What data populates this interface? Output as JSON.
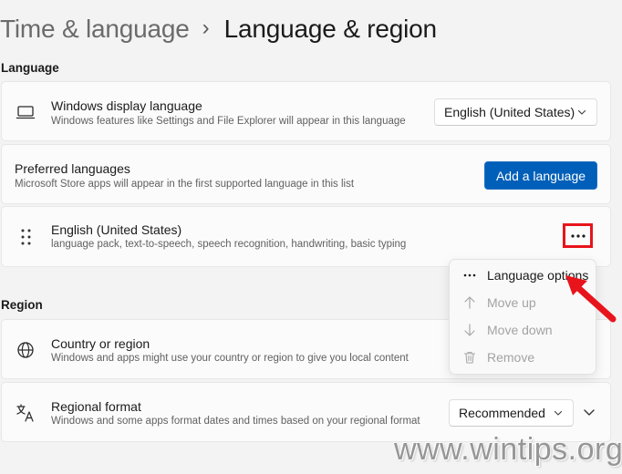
{
  "breadcrumb": {
    "parent": "Time & language",
    "separator": "›",
    "current": "Language & region"
  },
  "sections": {
    "language_label": "Language",
    "region_label": "Region"
  },
  "display_language": {
    "icon": "laptop-icon",
    "title": "Windows display language",
    "subtitle": "Windows features like Settings and File Explorer will appear in this language",
    "selected": "English (United States)"
  },
  "preferred_languages": {
    "title": "Preferred languages",
    "subtitle": "Microsoft Store apps will appear in the first supported language in this list",
    "add_button": "Add a language"
  },
  "language_entry": {
    "icon": "drag-handle-icon",
    "name": "English (United States)",
    "features": "language pack, text-to-speech, speech recognition, handwriting, basic typing",
    "more_label": "···"
  },
  "context_menu": {
    "items": [
      {
        "label": "Language options",
        "icon": "more-icon",
        "enabled": true
      },
      {
        "label": "Move up",
        "icon": "arrow-up-icon",
        "enabled": false
      },
      {
        "label": "Move down",
        "icon": "arrow-down-icon",
        "enabled": false
      },
      {
        "label": "Remove",
        "icon": "trash-icon",
        "enabled": false
      }
    ]
  },
  "country_region": {
    "icon": "globe-icon",
    "title": "Country or region",
    "subtitle": "Windows and apps might use your country or region to give you local content"
  },
  "regional_format": {
    "icon": "language-format-icon",
    "title": "Regional format",
    "subtitle": "Windows and some apps format dates and times based on your regional format",
    "selected": "Recommended"
  },
  "watermark": "www.wintips.org",
  "colors": {
    "accent": "#005fb8",
    "highlight": "#e8141c",
    "background": "#f3f3f3",
    "card": "#fbfbfb"
  }
}
